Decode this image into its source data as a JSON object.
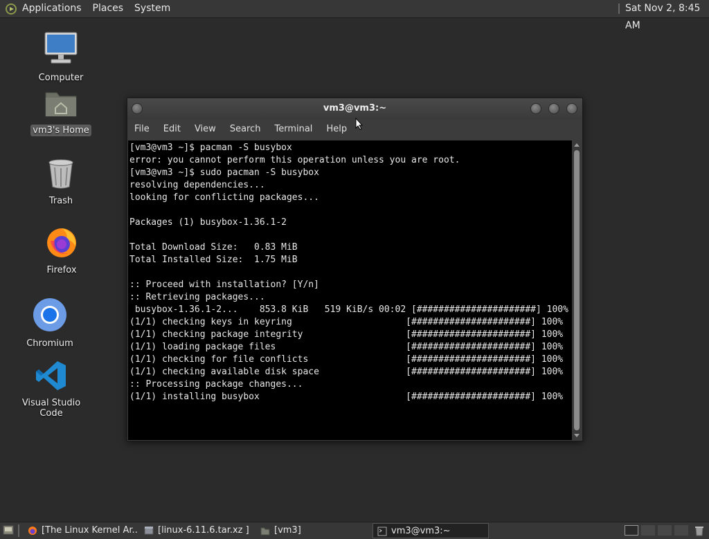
{
  "top_panel": {
    "menus": [
      "Applications",
      "Places",
      "System"
    ],
    "clock": "Sat Nov  2,  8:45 AM"
  },
  "desktop": {
    "icons": [
      {
        "label": "Computer",
        "icon": "computer-icon"
      },
      {
        "label": "vm3's Home",
        "icon": "home-folder-icon"
      },
      {
        "label": "Trash",
        "icon": "trash-icon"
      },
      {
        "label": "Firefox",
        "icon": "firefox-icon"
      },
      {
        "label": "Chromium",
        "icon": "chromium-icon"
      },
      {
        "label": "Visual Studio Code",
        "icon": "vscode-icon"
      }
    ]
  },
  "terminal": {
    "title": "vm3@vm3:~",
    "menu": [
      "File",
      "Edit",
      "View",
      "Search",
      "Terminal",
      "Help"
    ],
    "lines": [
      "[vm3@vm3 ~]$ pacman -S busybox",
      "error: you cannot perform this operation unless you are root.",
      "[vm3@vm3 ~]$ sudo pacman -S busybox",
      "resolving dependencies...",
      "looking for conflicting packages...",
      "",
      "Packages (1) busybox-1.36.1-2",
      "",
      "Total Download Size:   0.83 MiB",
      "Total Installed Size:  1.75 MiB",
      "",
      ":: Proceed with installation? [Y/n]",
      ":: Retrieving packages...",
      " busybox-1.36.1-2...    853.8 KiB   519 KiB/s 00:02 [######################] 100%",
      "(1/1) checking keys in keyring                     [######################] 100%",
      "(1/1) checking package integrity                   [######################] 100%",
      "(1/1) loading package files                        [######################] 100%",
      "(1/1) checking for file conflicts                  [######################] 100%",
      "(1/1) checking available disk space                [######################] 100%",
      ":: Processing package changes...",
      "(1/1) installing busybox                           [######################] 100%"
    ]
  },
  "taskbar": {
    "tasks": [
      {
        "label": "[The Linux Kernel Ar...",
        "icon": "firefox-icon",
        "active": false
      },
      {
        "label": "[linux-6.11.6.tar.xz ]",
        "icon": "archive-icon",
        "active": false
      },
      {
        "label": "[vm3]",
        "icon": "folder-icon",
        "active": false
      },
      {
        "label": "vm3@vm3:~",
        "icon": "terminal-icon",
        "active": true
      }
    ]
  },
  "colors": {
    "desktop_bg": "#2b2b2b",
    "panel_bg": "#373737",
    "terminal_bg": "#000000",
    "terminal_fg": "#e8e8e8"
  }
}
